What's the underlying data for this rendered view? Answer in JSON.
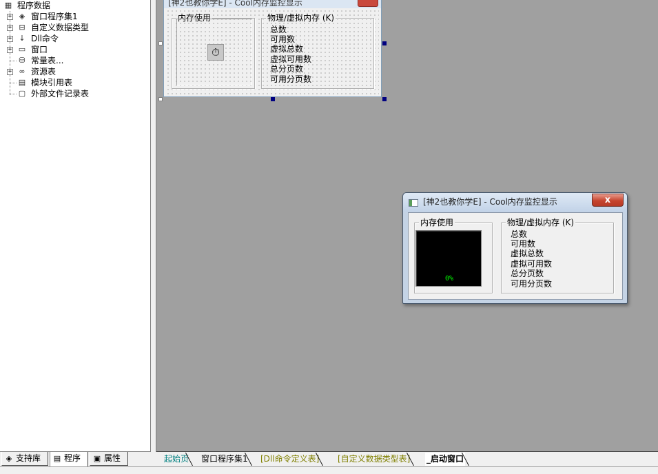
{
  "tree": {
    "root": "程序数据",
    "items": [
      {
        "label": "窗口程序集1",
        "icon": "window-module-icon"
      },
      {
        "label": "自定义数据类型",
        "icon": "custom-type-icon"
      },
      {
        "label": "Dll命令",
        "icon": "dll-command-icon"
      },
      {
        "label": "窗口",
        "icon": "window-icon"
      },
      {
        "label": "常量表...",
        "icon": "constant-table-icon"
      },
      {
        "label": "资源表",
        "icon": "resource-table-icon"
      },
      {
        "label": "模块引用表",
        "icon": "module-ref-icon"
      },
      {
        "label": "外部文件记录表",
        "icon": "external-file-icon"
      }
    ]
  },
  "design_form": {
    "title": "[神2也教你学E] - Cool内存监控显示",
    "group_memory": "内存使用",
    "group_phys": "物理/虚拟内存 (K)",
    "labels": [
      "总数",
      "可用数",
      "虚拟总数",
      "虚拟可用数",
      "总分页数",
      "可用分页数"
    ]
  },
  "preview": {
    "title": "[神2也教你学E] - Cool内存监控显示",
    "close_glyph": "x",
    "group_memory": "内存使用",
    "group_phys": "物理/虚拟内存 (K)",
    "labels": [
      "总数",
      "可用数",
      "虚拟总数",
      "虚拟可用数",
      "总分页数",
      "可用分页数"
    ],
    "percent": "0%"
  },
  "left_tabs": [
    "支持库",
    "程序",
    "属性"
  ],
  "editor_tabs": [
    {
      "label": "起始页",
      "color": "#008080"
    },
    {
      "label": "窗口程序集1",
      "color": "#000000"
    },
    {
      "label": "[Dll命令定义表]",
      "color": "#808000"
    },
    {
      "label": "[自定义数据类型表]",
      "color": "#808000"
    },
    {
      "label": "_启动窗口",
      "color": "#000000"
    }
  ]
}
